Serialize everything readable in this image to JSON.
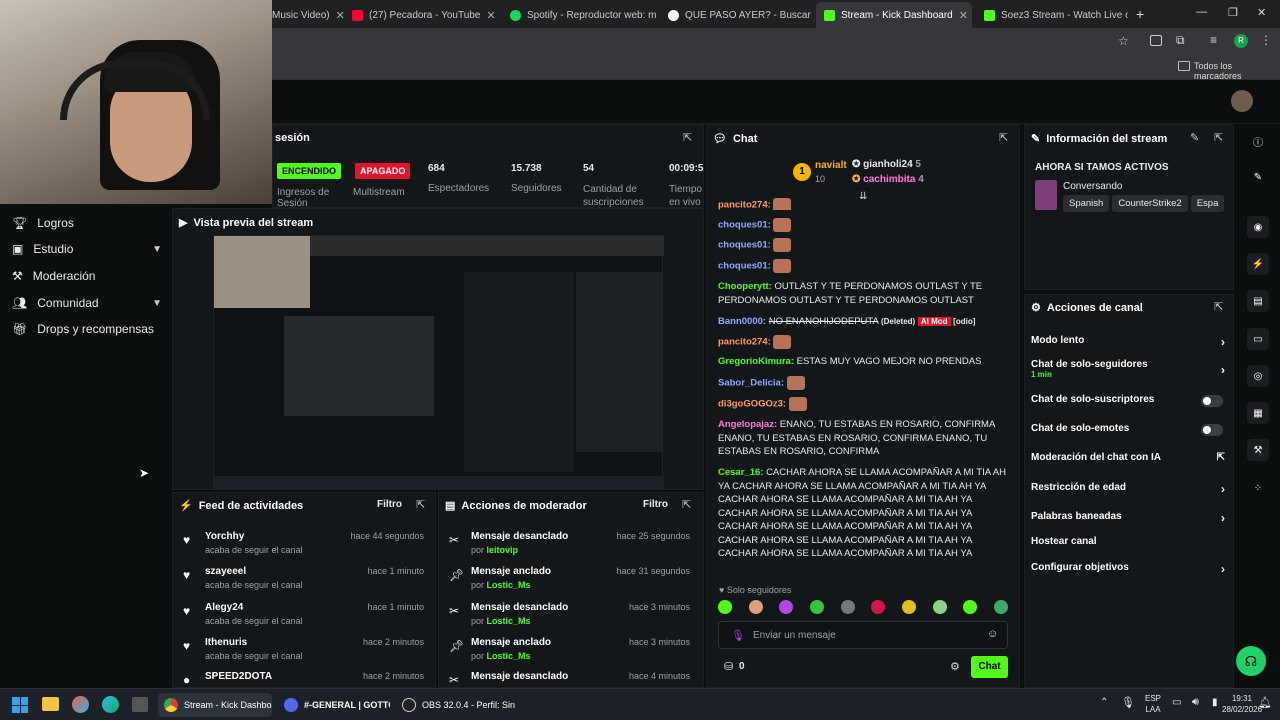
{
  "browser": {
    "tabs": [
      {
        "label": "Music Video)",
        "color": "#555"
      },
      {
        "label": "(27) Pecadora - YouTube",
        "color": "#ff0033"
      },
      {
        "label": "Spotify - Reproductor web: mú",
        "color": "#1ed760"
      },
      {
        "label": "QUE PASO AYER? - Buscar con",
        "color": "#fff"
      },
      {
        "label": "Stream - Kick Dashboard",
        "color": "#53fc18"
      },
      {
        "label": "Soez3 Stream - Watch Live on",
        "color": "#53fc18"
      }
    ],
    "bookmarks_label": "Todos los marcadores"
  },
  "session": {
    "title": "sesión",
    "stats": [
      {
        "value": "ENCENDIDO",
        "label": "Ingresos de Sesión"
      },
      {
        "value": "APAGADO",
        "label": "Multistream"
      },
      {
        "value": "684",
        "label": "Espectadores"
      },
      {
        "value": "15.738",
        "label": "Seguidores"
      },
      {
        "value": "54",
        "label": "Cantidad de suscripciones"
      },
      {
        "value": "00:09:5",
        "label": "Tiempo en vivo"
      }
    ]
  },
  "sidebar": {
    "items": [
      {
        "label": "Logros"
      },
      {
        "label": "Estudio"
      },
      {
        "label": "Moderación"
      },
      {
        "label": "Comunidad"
      },
      {
        "label": "Drops y recompensas"
      }
    ]
  },
  "preview": {
    "title": "Vista previa del stream"
  },
  "feed": {
    "title": "Feed de actividades",
    "filter": "Filtro",
    "rows": [
      {
        "name": "Yorchhy",
        "sub": "acaba de seguir el canal",
        "time": "hace 44 segundos"
      },
      {
        "name": "szayeeel",
        "sub": "acaba de seguir el canal",
        "time": "hace 1 minuto"
      },
      {
        "name": "Alegy24",
        "sub": "acaba de seguir el canal",
        "time": "hace 1 minuto"
      },
      {
        "name": "Ithenuris",
        "sub": "acaba de seguir el canal",
        "time": "hace 2 minutos"
      },
      {
        "name": "SPEED2DOTA",
        "sub": "",
        "time": "hace 2 minutos"
      }
    ]
  },
  "modactions": {
    "title": "Acciones de moderador",
    "filter": "Filtro",
    "rows": [
      {
        "name": "Mensaje desanclado",
        "by": "por",
        "mod": "leitovip",
        "time": "hace 25 segundos"
      },
      {
        "name": "Mensaje anclado",
        "by": "por",
        "mod": "Lostic_Ms",
        "time": "hace 31 segundos"
      },
      {
        "name": "Mensaje desanclado",
        "by": "por",
        "mod": "Lostic_Ms",
        "time": "hace 3 minutos"
      },
      {
        "name": "Mensaje anclado",
        "by": "por",
        "mod": "Lostic_Ms",
        "time": "hace 3 minutos"
      },
      {
        "name": "Mensaje desanclado",
        "by": "",
        "mod": "",
        "time": "hace 4 minutos"
      }
    ]
  },
  "chat": {
    "title": "Chat",
    "top": [
      {
        "rank": "1",
        "name": "navialt",
        "count": "10"
      },
      {
        "name": "gianholi24",
        "count": "5"
      },
      {
        "name": "cachimbita",
        "count": "4"
      }
    ],
    "messages": [
      {
        "user": "pancito274:",
        "color": "#ff9d5c",
        "text": ""
      },
      {
        "user": "choques01:",
        "color": "#8fa9ff",
        "text": ""
      },
      {
        "user": "choques01:",
        "color": "#8fa9ff",
        "text": ""
      },
      {
        "user": "choques01:",
        "color": "#8fa9ff",
        "text": ""
      },
      {
        "user": "Chooperytt:",
        "color": "#53fc18",
        "text": "OUTLAST Y TE PERDONAMOS  OUTLAST Y TE PERDONAMOS  OUTLAST Y TE PERDONAMOS  OUTLAST"
      },
      {
        "user": "Bann0000:",
        "color": "#8fa9ff",
        "text": "NO ENANOHIJODEPUTA",
        "deleted": "(Deleted)",
        "mod": "AI Mod",
        "tag": "[odio]"
      },
      {
        "user": "pancito274:",
        "color": "#ff9d5c",
        "text": ""
      },
      {
        "user": "GregorioKimura:",
        "color": "#53fc18",
        "text": "ESTAS MUY VAGO MEJOR NO PRENDAS"
      },
      {
        "user": "Sabor_Delicia:",
        "color": "#8fa9ff",
        "text": ""
      },
      {
        "user": "di3goGOGOz3:",
        "color": "#ff9d5c",
        "text": ""
      },
      {
        "user": "Angelopajaz:",
        "color": "#ff7ad9",
        "text": "ENANO, TU ESTABAS EN ROSARIO, CONFIRMA  ENANO, TU ESTABAS EN ROSARIO, CONFIRMA  ENANO, TU ESTABAS EN ROSARIO, CONFIRMA"
      },
      {
        "user": "Cesar_16:",
        "color": "#53fc18",
        "text": "CACHAR AHORA SE LLAMA ACOMPAÑAR A MI TIA AH YA CACHAR AHORA SE LLAMA ACOMPAÑAR A MI TIA AH YA CACHAR AHORA SE LLAMA ACOMPAÑAR A MI TIA AH YA CACHAR AHORA SE LLAMA ACOMPAÑAR A MI TIA AH YA CACHAR AHORA SE LLAMA ACOMPAÑAR A MI TIA AH YA CACHAR AHORA SE LLAMA ACOMPAÑAR A MI TIA AH YA CACHAR AHORA SE LLAMA ACOMPAÑAR A MI TIA AH YA"
      }
    ],
    "mode": "Solo seguidores",
    "placeholder": "Enviar un mensaje",
    "points": "0",
    "send": "Chat"
  },
  "info": {
    "title": "Información del stream",
    "stream_title": "AHORA SI TAMOS ACTIVOS",
    "category": "Conversando",
    "tags": [
      "Spanish",
      "CounterStrike2",
      "Espa"
    ]
  },
  "actions": {
    "title": "Acciones de canal",
    "rows": [
      {
        "label": "Modo lento",
        "kind": "chev"
      },
      {
        "label": "Chat de solo-seguidores",
        "sub": "1 min",
        "kind": "chev"
      },
      {
        "label": "Chat de solo-suscriptores",
        "kind": "toggle"
      },
      {
        "label": "Chat de solo-emotes",
        "kind": "toggle"
      },
      {
        "label": "Moderación del chat con IA",
        "kind": "ext"
      },
      {
        "label": "Restricción de edad",
        "kind": "chev"
      },
      {
        "label": "Palabras baneadas",
        "kind": "chev"
      },
      {
        "label": "Hostear canal",
        "kind": "none"
      },
      {
        "label": "Configurar objetivos",
        "kind": "chev"
      }
    ]
  },
  "taskbar": {
    "apps": [
      {
        "label": "Stream - Kick Dashboan"
      },
      {
        "label": "#-GENERAL | GOTTO"
      },
      {
        "label": "OBS 32.0.4 - Perfil: Sin T"
      }
    ],
    "lang": "ESP",
    "lang2": "LAA",
    "time": "19:31",
    "date": "28/02/2026"
  }
}
